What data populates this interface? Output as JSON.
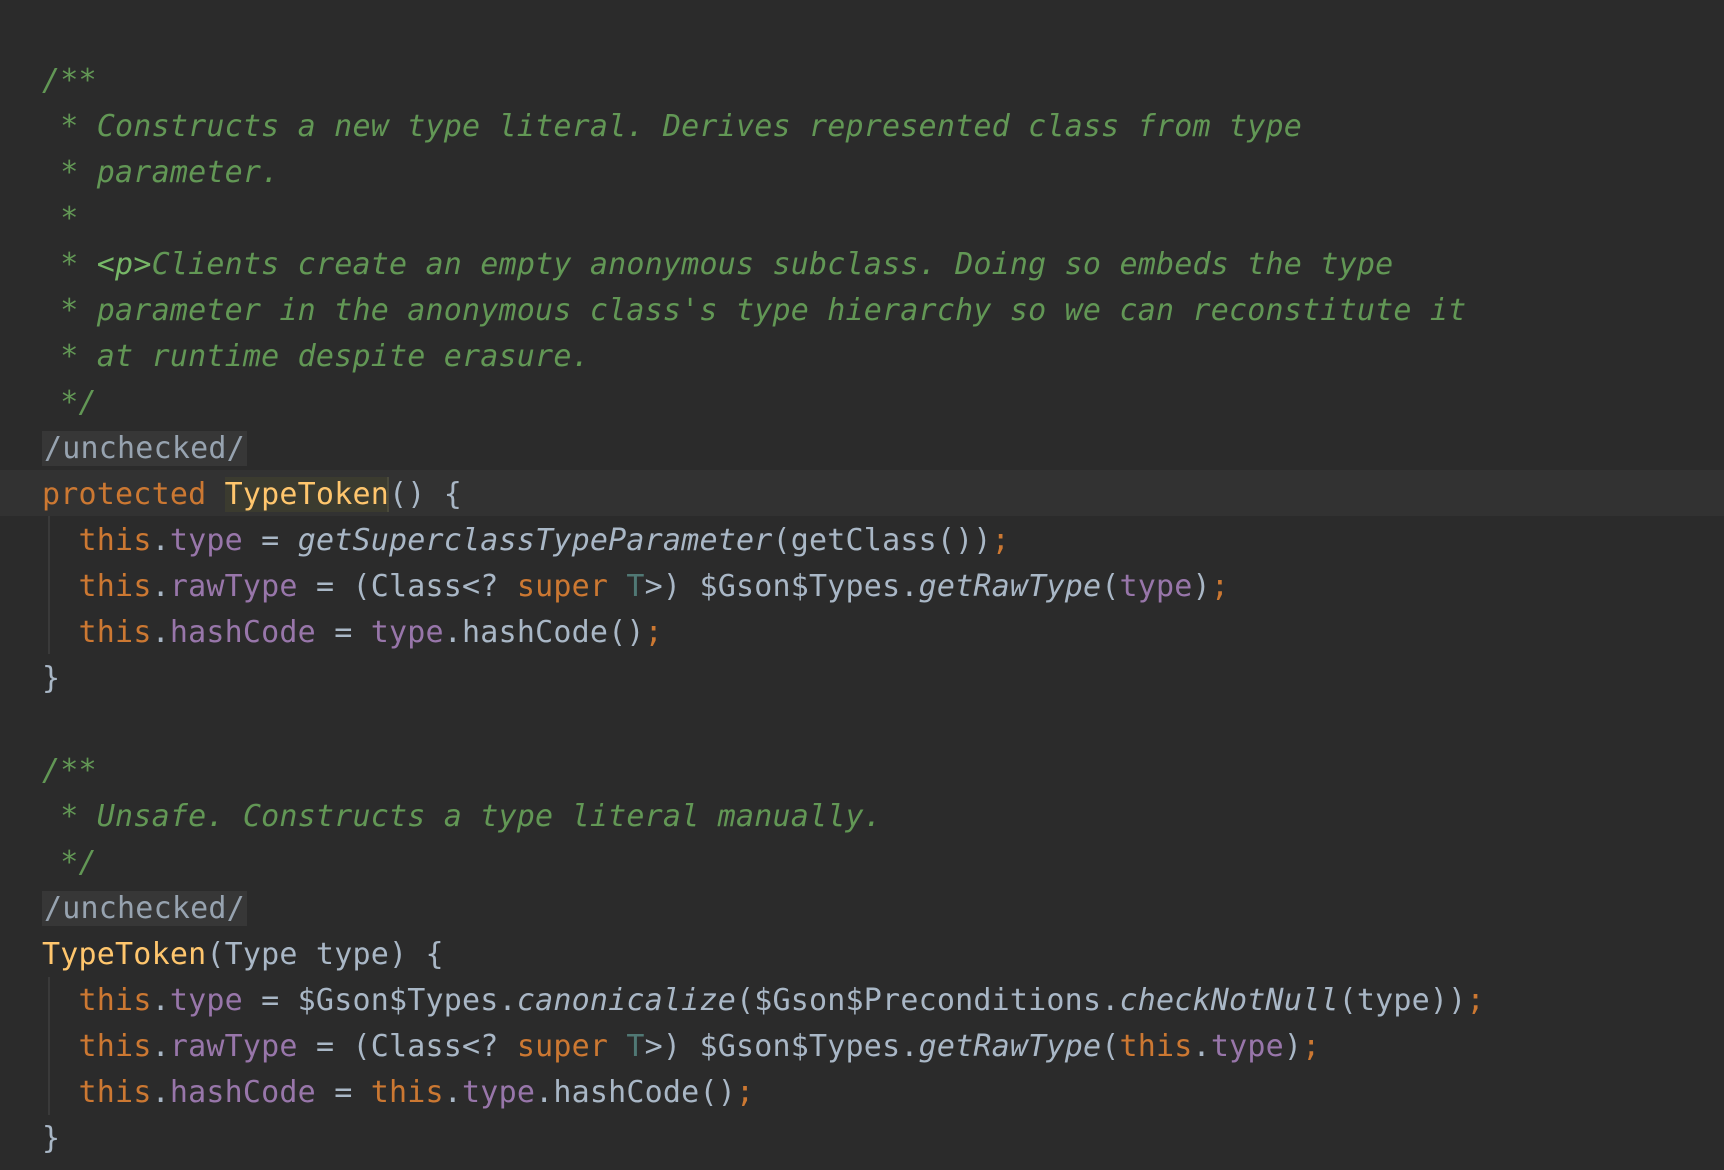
{
  "editor": {
    "lines": [
      {
        "id": "line-1",
        "segments": [
          {
            "text": "/**",
            "class": "tok-comment"
          }
        ]
      },
      {
        "id": "line-2",
        "segments": [
          {
            "text": " * Constructs a new type literal. Derives represented class from type",
            "class": "tok-comment"
          }
        ]
      },
      {
        "id": "line-3",
        "segments": [
          {
            "text": " * parameter.",
            "class": "tok-comment"
          }
        ]
      },
      {
        "id": "line-4",
        "segments": [
          {
            "text": " *",
            "class": "tok-comment"
          }
        ]
      },
      {
        "id": "line-5",
        "segments": [
          {
            "text": " * ",
            "class": "tok-comment"
          },
          {
            "text": "<p>",
            "class": "tok-tag"
          },
          {
            "text": "Clients create an empty anonymous subclass. Doing so embeds the type",
            "class": "tok-comment"
          }
        ]
      },
      {
        "id": "line-6",
        "segments": [
          {
            "text": " * parameter in the anonymous class's type hierarchy so we can reconstitute it",
            "class": "tok-comment"
          }
        ]
      },
      {
        "id": "line-7",
        "segments": [
          {
            "text": " * at runtime despite erasure.",
            "class": "tok-comment"
          }
        ]
      },
      {
        "id": "line-8",
        "segments": [
          {
            "text": " */",
            "class": "tok-comment"
          }
        ]
      },
      {
        "id": "line-9",
        "segments": [
          {
            "text": "/unchecked/",
            "class": "tok-annot"
          }
        ]
      },
      {
        "id": "line-10",
        "segments": [
          {
            "text": "protected",
            "class": "tok-kw"
          },
          {
            "text": " ",
            "class": "tok-default"
          },
          {
            "text": "TypeToken",
            "class": "tok-fn-def token-highlight"
          },
          {
            "text": "() {",
            "class": "tok-default"
          }
        ]
      },
      {
        "id": "line-11",
        "segments": [
          {
            "text": "  ",
            "class": "tok-default"
          },
          {
            "text": "this",
            "class": "tok-kw"
          },
          {
            "text": ".",
            "class": "tok-default"
          },
          {
            "text": "type",
            "class": "tok-field"
          },
          {
            "text": " = ",
            "class": "tok-default"
          },
          {
            "text": "getSuperclassTypeParameter",
            "class": "tok-italic-call"
          },
          {
            "text": "(getClass())",
            "class": "tok-default"
          },
          {
            "text": ";",
            "class": "tok-punct"
          }
        ]
      },
      {
        "id": "line-12",
        "segments": [
          {
            "text": "  ",
            "class": "tok-default"
          },
          {
            "text": "this",
            "class": "tok-kw"
          },
          {
            "text": ".",
            "class": "tok-default"
          },
          {
            "text": "rawType",
            "class": "tok-field"
          },
          {
            "text": " = (Class<? ",
            "class": "tok-default"
          },
          {
            "text": "super",
            "class": "tok-kw"
          },
          {
            "text": " ",
            "class": "tok-default"
          },
          {
            "text": "T",
            "class": "tok-type-param"
          },
          {
            "text": ">) $Gson$Types.",
            "class": "tok-default"
          },
          {
            "text": "getRawType",
            "class": "tok-italic-call"
          },
          {
            "text": "(",
            "class": "tok-default"
          },
          {
            "text": "type",
            "class": "tok-field"
          },
          {
            "text": ")",
            "class": "tok-default"
          },
          {
            "text": ";",
            "class": "tok-punct"
          }
        ]
      },
      {
        "id": "line-13",
        "segments": [
          {
            "text": "  ",
            "class": "tok-default"
          },
          {
            "text": "this",
            "class": "tok-kw"
          },
          {
            "text": ".",
            "class": "tok-default"
          },
          {
            "text": "hashCode",
            "class": "tok-field"
          },
          {
            "text": " = ",
            "class": "tok-default"
          },
          {
            "text": "type",
            "class": "tok-field"
          },
          {
            "text": ".hashCode()",
            "class": "tok-default"
          },
          {
            "text": ";",
            "class": "tok-punct"
          }
        ]
      },
      {
        "id": "line-14",
        "segments": [
          {
            "text": "}",
            "class": "tok-default"
          }
        ]
      },
      {
        "id": "line-15",
        "segments": [
          {
            "text": "/**",
            "class": "tok-comment"
          }
        ]
      },
      {
        "id": "line-16",
        "segments": [
          {
            "text": " * Unsafe. Constructs a type literal manually.",
            "class": "tok-comment"
          }
        ]
      },
      {
        "id": "line-17",
        "segments": [
          {
            "text": " */",
            "class": "tok-comment"
          }
        ]
      },
      {
        "id": "line-18",
        "segments": [
          {
            "text": "/unchecked/",
            "class": "tok-annot"
          }
        ]
      },
      {
        "id": "line-19",
        "segments": [
          {
            "text": "TypeToken",
            "class": "tok-fn-def"
          },
          {
            "text": "(Type type) {",
            "class": "tok-default"
          }
        ]
      },
      {
        "id": "line-20",
        "segments": [
          {
            "text": "  ",
            "class": "tok-default"
          },
          {
            "text": "this",
            "class": "tok-kw"
          },
          {
            "text": ".",
            "class": "tok-default"
          },
          {
            "text": "type",
            "class": "tok-field"
          },
          {
            "text": " = $Gson$Types.",
            "class": "tok-default"
          },
          {
            "text": "canonicalize",
            "class": "tok-italic-call"
          },
          {
            "text": "($Gson$Preconditions.",
            "class": "tok-default"
          },
          {
            "text": "checkNotNull",
            "class": "tok-italic-call"
          },
          {
            "text": "(type))",
            "class": "tok-default"
          },
          {
            "text": ";",
            "class": "tok-punct"
          }
        ]
      },
      {
        "id": "line-21",
        "segments": [
          {
            "text": "  ",
            "class": "tok-default"
          },
          {
            "text": "this",
            "class": "tok-kw"
          },
          {
            "text": ".",
            "class": "tok-default"
          },
          {
            "text": "rawType",
            "class": "tok-field"
          },
          {
            "text": " = (Class<? ",
            "class": "tok-default"
          },
          {
            "text": "super",
            "class": "tok-kw"
          },
          {
            "text": " ",
            "class": "tok-default"
          },
          {
            "text": "T",
            "class": "tok-type-param"
          },
          {
            "text": ">) $Gson$Types.",
            "class": "tok-default"
          },
          {
            "text": "getRawType",
            "class": "tok-italic-call"
          },
          {
            "text": "(",
            "class": "tok-default"
          },
          {
            "text": "this",
            "class": "tok-kw"
          },
          {
            "text": ".",
            "class": "tok-default"
          },
          {
            "text": "type",
            "class": "tok-field"
          },
          {
            "text": ")",
            "class": "tok-default"
          },
          {
            "text": ";",
            "class": "tok-punct"
          }
        ]
      },
      {
        "id": "line-22",
        "segments": [
          {
            "text": "  ",
            "class": "tok-default"
          },
          {
            "text": "this",
            "class": "tok-kw"
          },
          {
            "text": ".",
            "class": "tok-default"
          },
          {
            "text": "hashCode",
            "class": "tok-field"
          },
          {
            "text": " = ",
            "class": "tok-default"
          },
          {
            "text": "this",
            "class": "tok-kw"
          },
          {
            "text": ".",
            "class": "tok-default"
          },
          {
            "text": "type",
            "class": "tok-field"
          },
          {
            "text": ".hashCode()",
            "class": "tok-default"
          },
          {
            "text": ";",
            "class": "tok-punct"
          }
        ]
      },
      {
        "id": "line-23",
        "segments": [
          {
            "text": "}",
            "class": "tok-default"
          }
        ]
      }
    ]
  }
}
